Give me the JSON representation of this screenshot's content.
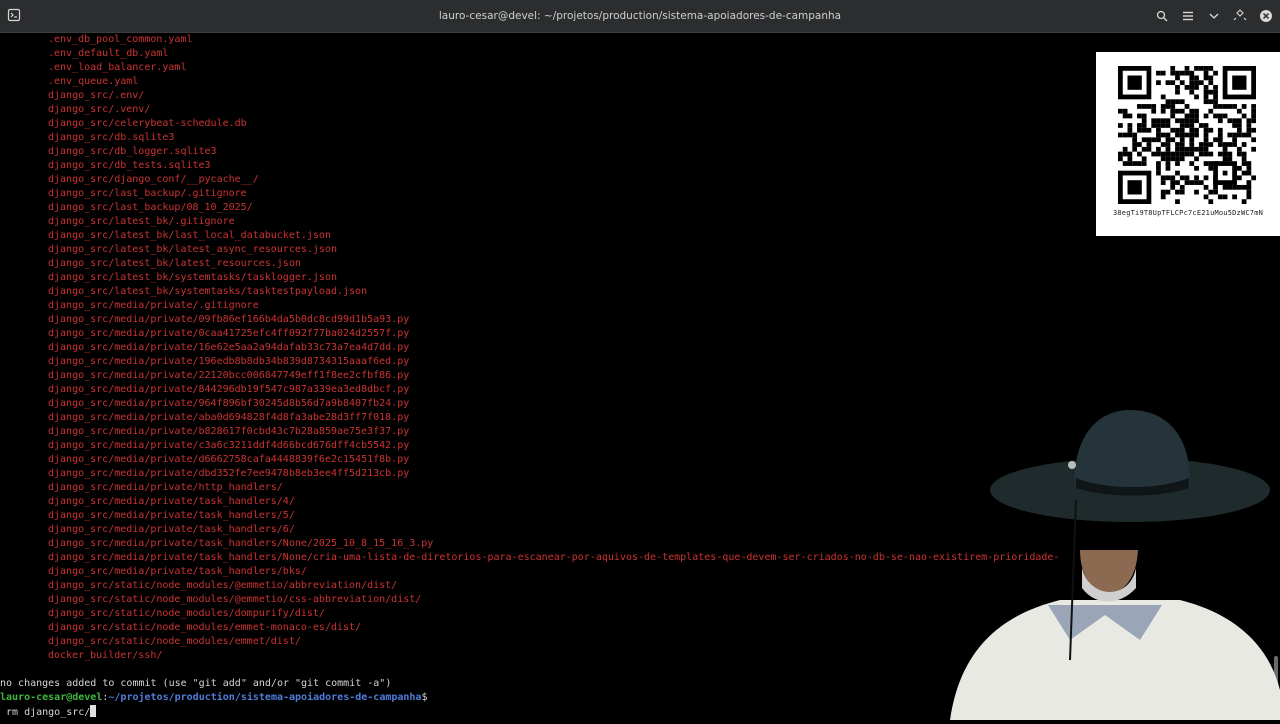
{
  "window": {
    "title": "lauro-cesar@devel: ~/projetos/production/sistema-apoiadores-de-campanha",
    "icons": {
      "new_tab": "new-tab-icon",
      "search": "search-icon",
      "menu": "hamburger-menu-icon",
      "dropdown": "chevron-down-icon",
      "maximize": "maximize-icon",
      "close": "close-icon"
    }
  },
  "terminal": {
    "untracked_files": [
      ".env_db_pool_common.yaml",
      ".env_default_db.yaml",
      ".env_load_balancer.yaml",
      ".env_queue.yaml",
      "django_src/.env/",
      "django_src/.venv/",
      "django_src/celerybeat-schedule.db",
      "django_src/db.sqlite3",
      "django_src/db_logger.sqlite3",
      "django_src/db_tests.sqlite3",
      "django_src/django_conf/__pycache__/",
      "django_src/last_backup/.gitignore",
      "django_src/last_backup/08_10_2025/",
      "django_src/latest_bk/.gitignore",
      "django_src/latest_bk/last_local_databucket.json",
      "django_src/latest_bk/latest_async_resources.json",
      "django_src/latest_bk/latest_resources.json",
      "django_src/latest_bk/systemtasks/tasklogger.json",
      "django_src/latest_bk/systemtasks/tasktestpayload.json",
      "django_src/media/private/.gitignore",
      "django_src/media/private/09fb86ef166b4da5b0dc8cd99d1b5a93.py",
      "django_src/media/private/0caa41725efc4ff092f77ba024d2557f.py",
      "django_src/media/private/16e62e5aa2a94dafab33c73a7ea4d7dd.py",
      "django_src/media/private/196edb8b8db34b839d8734315aaaf6ed.py",
      "django_src/media/private/22120bcc006847749eff1f8ee2cfbf86.py",
      "django_src/media/private/844296db19f547c987a339ea3ed8dbcf.py",
      "django_src/media/private/964f896bf30245d8b56d7a9b8407fb24.py",
      "django_src/media/private/aba0d694828f4d8fa3abe28d3ff7f018.py",
      "django_src/media/private/b828617f0cbd43c7b28a859ae75e3f37.py",
      "django_src/media/private/c3a6c3211ddf4d66bcd676dff4cb5542.py",
      "django_src/media/private/d6662758cafa4448839f6e2c15451f8b.py",
      "django_src/media/private/dbd352fe7ee9478b8eb3ee4ff5d213cb.py",
      "django_src/media/private/http_handlers/",
      "django_src/media/private/task_handlers/4/",
      "django_src/media/private/task_handlers/5/",
      "django_src/media/private/task_handlers/6/",
      "django_src/media/private/task_handlers/None/2025_10_8_15_16_3.py",
      "django_src/media/private/task_handlers/None/cria-uma-lista-de-diretorios-para-escanear-por-aquivos-de-templates-que-devem-ser-criados-no-db-se-nao-existirem-prioridade-",
      "django_src/media/private/task_handlers/bks/",
      "django_src/static/node_modules/@emmetio/abbreviation/dist/",
      "django_src/static/node_modules/@emmetio/css-abbreviation/dist/",
      "django_src/static/node_modules/dompurify/dist/",
      "django_src/static/node_modules/emmet-monaco-es/dist/",
      "django_src/static/node_modules/emmet/dist/",
      "docker_builder/ssh/"
    ],
    "status_message": "no changes added to commit (use \"git add\" and/or \"git commit -a\")",
    "prompt_user_host": "lauro-cesar@devel",
    "prompt_separator": ":",
    "prompt_path": "~/projetos/production/sistema-apoiadores-de-campanha",
    "prompt_symbol": "$",
    "current_input": " rm django_src/"
  },
  "qr_overlay": {
    "caption": "38egTi9T8UpTFLCPc7cE21uMou5DzWC7mN"
  }
}
